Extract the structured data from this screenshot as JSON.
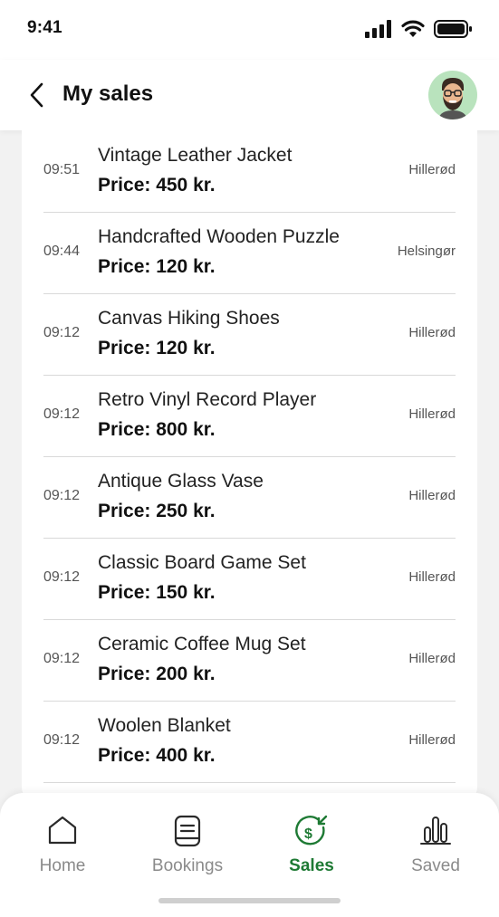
{
  "status_bar": {
    "time": "9:41"
  },
  "header": {
    "title": "My sales"
  },
  "sales": [
    {
      "time": "09:51",
      "name": "Vintage Leather Jacket",
      "price": "Price: 450 kr.",
      "city": "Hillerød"
    },
    {
      "time": "09:44",
      "name": "Handcrafted Wooden Puzzle",
      "price": "Price: 120 kr.",
      "city": "Helsingør"
    },
    {
      "time": "09:12",
      "name": "Canvas Hiking Shoes",
      "price": "Price: 120 kr.",
      "city": "Hillerød"
    },
    {
      "time": "09:12",
      "name": "Retro Vinyl Record Player",
      "price": "Price: 800 kr.",
      "city": "Hillerød"
    },
    {
      "time": "09:12",
      "name": "Antique Glass Vase",
      "price": "Price: 250 kr.",
      "city": "Hillerød"
    },
    {
      "time": "09:12",
      "name": "Classic Board Game Set",
      "price": "Price: 150 kr.",
      "city": "Hillerød"
    },
    {
      "time": "09:12",
      "name": "Ceramic Coffee Mug Set",
      "price": "Price: 200 kr.",
      "city": "Hillerød"
    },
    {
      "time": "09:12",
      "name": "Woolen Blanket",
      "price": "Price: 400 kr.",
      "city": "Hillerød"
    }
  ],
  "tabs": [
    {
      "label": "Home",
      "icon": "home-icon",
      "active": false
    },
    {
      "label": "Bookings",
      "icon": "bookings-icon",
      "active": false
    },
    {
      "label": "Sales",
      "icon": "sales-icon",
      "active": true
    },
    {
      "label": "Saved",
      "icon": "chart-icon",
      "active": false
    }
  ],
  "colors": {
    "accent": "#1e7a34",
    "avatar_bg": "#b9e3bd",
    "inactive": "#8a8a8a"
  }
}
